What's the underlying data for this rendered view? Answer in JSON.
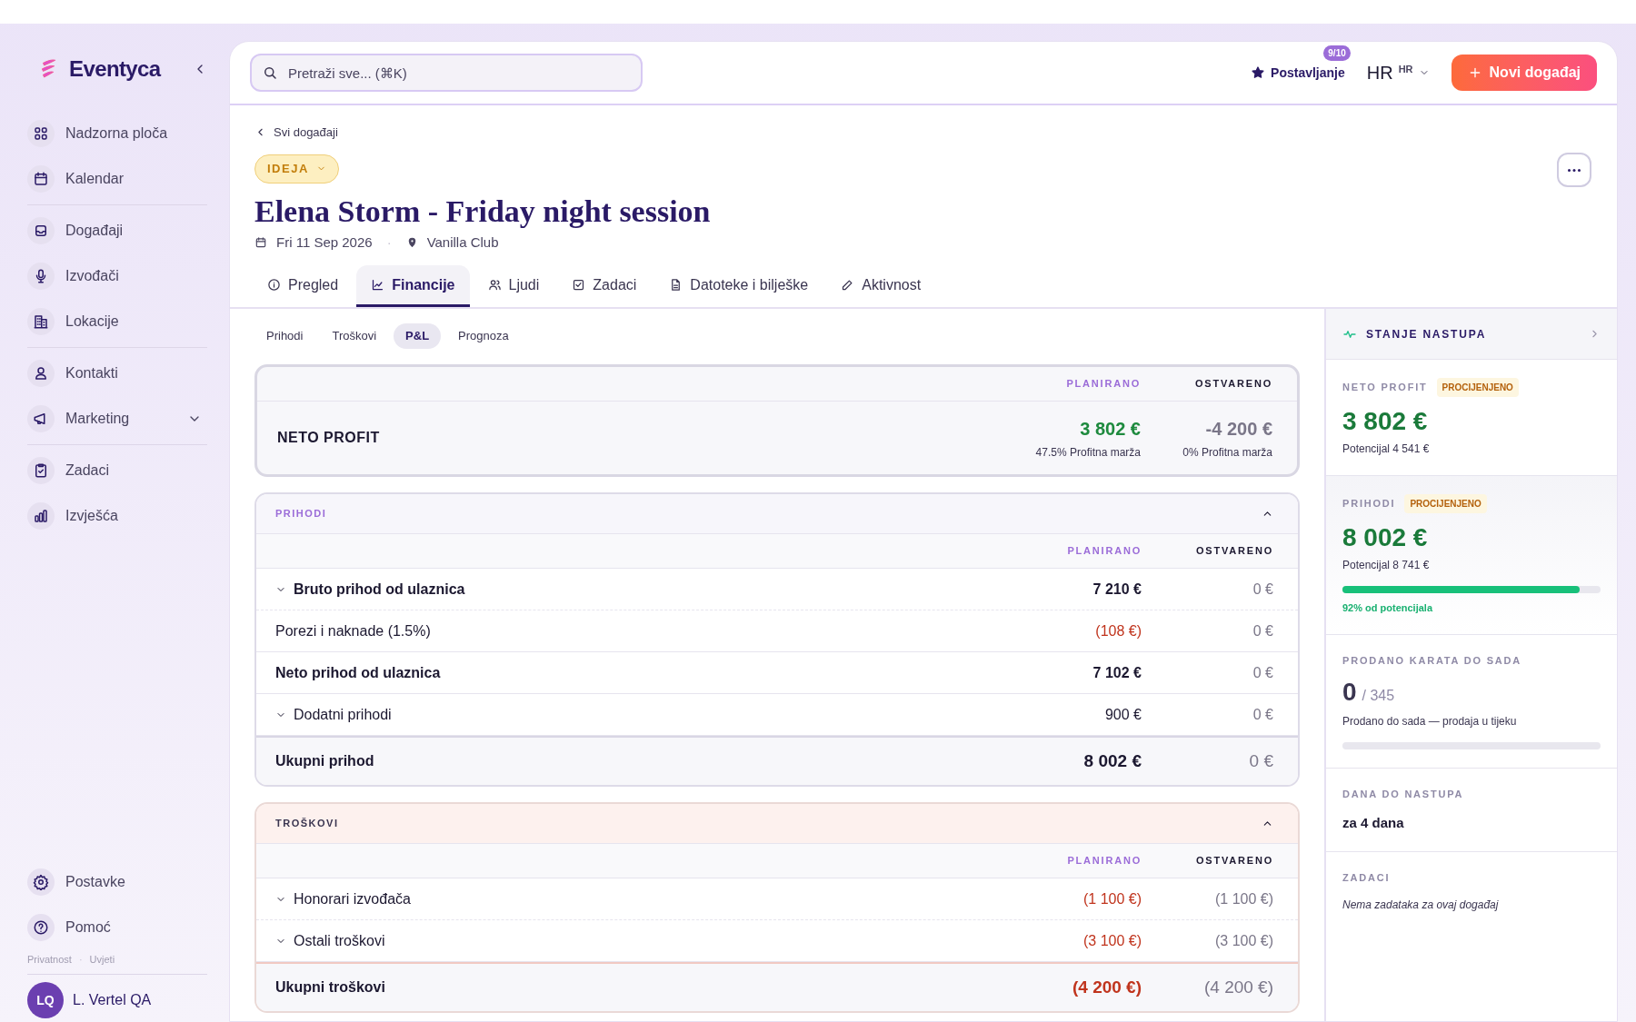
{
  "sidebar": {
    "brand": "Eventyca",
    "groups": [
      [
        {
          "label": "Nadzorna ploča",
          "kind": "link"
        },
        {
          "label": "Kalendar",
          "kind": "link"
        }
      ],
      [
        {
          "label": "Događaji",
          "kind": "link"
        },
        {
          "label": "Izvođači",
          "kind": "link"
        },
        {
          "label": "Lokacije",
          "kind": "link"
        }
      ],
      [
        {
          "label": "Kontakti",
          "kind": "link"
        },
        {
          "label": "Marketing",
          "kind": "group"
        }
      ],
      [
        {
          "label": "Zadaci",
          "kind": "link"
        },
        {
          "label": "Izvješća",
          "kind": "link"
        }
      ]
    ],
    "bottom_items": [
      {
        "label": "Postavke"
      },
      {
        "label": "Pomoć"
      }
    ],
    "footer_links": [
      "Privatnost",
      "Uvjeti"
    ],
    "footer_separator": "·",
    "user": {
      "initials": "LQ",
      "name": "L. Vertel QA"
    }
  },
  "header": {
    "search": {
      "placeholder": "Pretraži sve... (⌘K)"
    },
    "setup": {
      "label": "Postavljanje",
      "badge": "9/10"
    },
    "language": {
      "code": "HR",
      "small": "HR"
    },
    "new_button": "Novi događaj"
  },
  "event": {
    "back": "Svi događaji",
    "status": "IDEJA",
    "title": "Elena Storm - Friday night session",
    "date": "Fri 11 Sep 2026",
    "venue": "Vanilla Club",
    "separator": "·"
  },
  "tabs": [
    {
      "label": "Pregled",
      "selected": false
    },
    {
      "label": "Financije",
      "selected": true
    },
    {
      "label": "Ljudi",
      "selected": false
    },
    {
      "label": "Zadaci",
      "selected": false
    },
    {
      "label": "Datoteke i bilješke",
      "selected": false
    },
    {
      "label": "Aktivnost",
      "selected": false
    }
  ],
  "subtabs": [
    {
      "label": "Prihodi",
      "selected": false
    },
    {
      "label": "Troškovi",
      "selected": false
    },
    {
      "label": "P&L",
      "selected": true
    },
    {
      "label": "Prognoza",
      "selected": false
    }
  ],
  "net_profit": {
    "columns": [
      "PLANIRANO",
      "OSTVARENO"
    ],
    "label": "NETO PROFIT",
    "planned": {
      "value": "3 802 €",
      "note": "47.5% Profitna marža",
      "positive": true
    },
    "actual": {
      "value": "-4 200 €",
      "note": "0% Profitna marža",
      "positive": false
    }
  },
  "sections": [
    {
      "title": "PRIHODI",
      "kind": "income",
      "columns": [
        "PLANIRANO",
        "OSTVARENO"
      ],
      "rows": [
        {
          "label": "Bruto prihod od ulaznica",
          "bold": true,
          "expandable": true,
          "planned": "7 210 €",
          "negative": false,
          "actual": "0 €"
        },
        {
          "label": "Porezi i naknade (1.5%)",
          "bold": false,
          "expandable": false,
          "planned": "(108 €)",
          "negative": true,
          "actual": "0 €"
        },
        {
          "label": "Neto prihod od ulaznica",
          "bold": true,
          "expandable": false,
          "planned": "7 102 €",
          "negative": false,
          "actual": "0 €"
        },
        {
          "label": "Dodatni prihodi",
          "bold": false,
          "expandable": true,
          "planned": "900 €",
          "negative": false,
          "actual": "0 €"
        }
      ],
      "total": {
        "label": "Ukupni prihod",
        "planned": "8 002 €",
        "negative": false,
        "actual": "0 €"
      }
    },
    {
      "title": "TROŠKOVI",
      "kind": "expense",
      "columns": [
        "PLANIRANO",
        "OSTVARENO"
      ],
      "rows": [
        {
          "label": "Honorari izvođača",
          "bold": false,
          "expandable": true,
          "planned": "(1 100 €)",
          "negative": true,
          "actual": "(1 100 €)"
        },
        {
          "label": "Ostali troškovi",
          "bold": false,
          "expandable": true,
          "planned": "(3 100 €)",
          "negative": true,
          "actual": "(3 100 €)"
        }
      ],
      "total": {
        "label": "Ukupni troškovi",
        "planned": "(4 200 €)",
        "negative": true,
        "actual": "(4 200 €)"
      }
    }
  ],
  "status_panel": {
    "title": "STANJE NASTUPA",
    "cards": [
      {
        "kind": "money",
        "label": "NETO PROFIT",
        "badge": "PROCIJENJENO",
        "value": "3 802 €",
        "sub": "Potencijal 4 541 €"
      },
      {
        "kind": "progress",
        "label": "PRIHODI",
        "badge": "PROCIJENJENO",
        "value": "8 002 €",
        "sub": "Potencijal 8 741 €",
        "level": 0.92,
        "caption": "92% od potencijala"
      },
      {
        "kind": "tickets",
        "label": "PRODANO KARATA DO SADA",
        "value": "0",
        "total": "/ 345",
        "sub": "Prodano do sada — prodaja u tijeku",
        "level": 0
      },
      {
        "kind": "text",
        "label": "DANA DO NASTUPA",
        "value": "za 4 dana"
      },
      {
        "kind": "empty",
        "label": "ZADACI",
        "note": "Nema zadataka za ovaj događaj"
      }
    ]
  }
}
